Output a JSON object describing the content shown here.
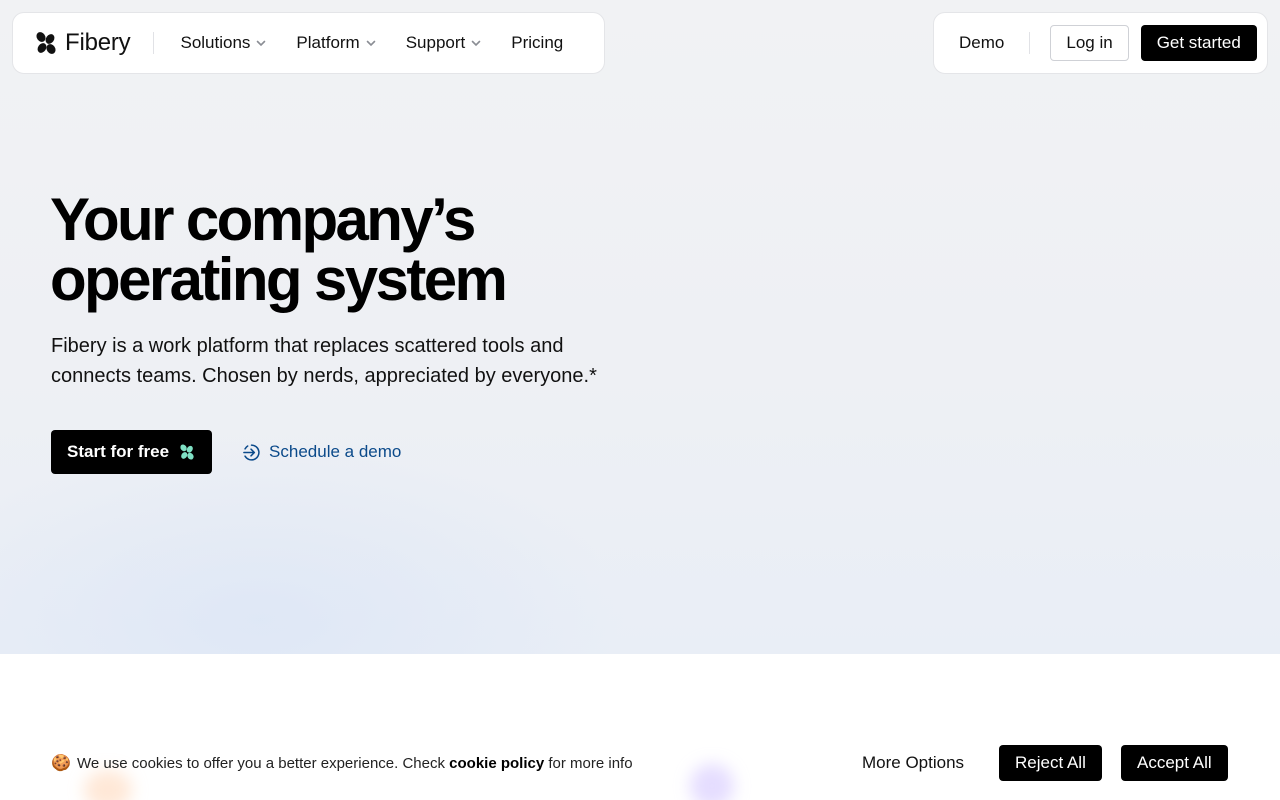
{
  "nav": {
    "logo_text": "Fibery",
    "items": [
      {
        "label": "Solutions",
        "has_dropdown": true
      },
      {
        "label": "Platform",
        "has_dropdown": true
      },
      {
        "label": "Support",
        "has_dropdown": true
      },
      {
        "label": "Pricing",
        "has_dropdown": false
      }
    ],
    "demo_label": "Demo",
    "login_label": "Log in",
    "get_started_label": "Get started"
  },
  "hero": {
    "headline_line1": "Your company’s",
    "headline_line2": "operating system",
    "subtitle_line1": "Fibery is a work platform that replaces scattered tools and",
    "subtitle_line2": "connects teams. Chosen by nerds, appreciated by everyone.*",
    "start_label": "Start for free",
    "schedule_label": "Schedule a demo"
  },
  "cookie": {
    "emoji": "🍪",
    "text_before": "We use cookies to offer you a better experience. Check ",
    "policy_link": "cookie policy",
    "text_after": " for more info",
    "more_options_label": "More Options",
    "reject_label": "Reject All",
    "accept_label": "Accept All"
  },
  "colors": {
    "accent_link": "#0b4a8a",
    "button_bg": "#000000",
    "mint_icon": "#7fe0c4"
  },
  "icons": {
    "logo": "fibery-logo-icon",
    "chevron": "chevron-down-icon",
    "start": "fibery-mint-icon",
    "schedule": "arrow-into-circle-icon"
  }
}
